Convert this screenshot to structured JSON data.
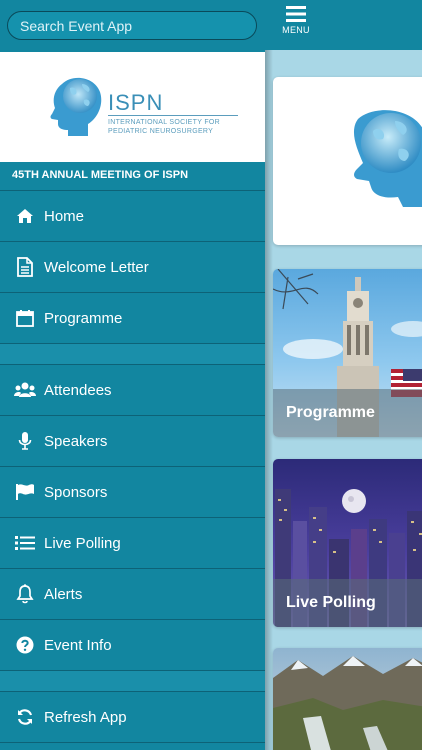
{
  "search": {
    "placeholder": "Search Event App"
  },
  "logo": {
    "name": "ISPN",
    "subtitle": "INTERNATIONAL SOCIETY FOR PEDIATRIC NEUROSURGERY"
  },
  "meeting_title": "45TH ANNUAL MEETING OF ISPN",
  "menu": {
    "items": [
      {
        "label": "Home",
        "icon": "home-icon"
      },
      {
        "label": "Welcome Letter",
        "icon": "document-icon"
      },
      {
        "label": "Programme",
        "icon": "calendar-icon"
      },
      {
        "label": "Attendees",
        "icon": "users-icon"
      },
      {
        "label": "Speakers",
        "icon": "microphone-icon"
      },
      {
        "label": "Sponsors",
        "icon": "flag-icon"
      },
      {
        "label": "Live Polling",
        "icon": "list-icon"
      },
      {
        "label": "Alerts",
        "icon": "bell-icon"
      },
      {
        "label": "Event Info",
        "icon": "question-icon"
      },
      {
        "label": "Refresh App",
        "icon": "refresh-icon"
      }
    ]
  },
  "topbar": {
    "menu_label": "MENU"
  },
  "cards": [
    {
      "label": ""
    },
    {
      "label": "Programme"
    },
    {
      "label": "Live Polling"
    },
    {
      "label": ""
    }
  ],
  "colors": {
    "primary": "#1286a0",
    "divider": "#0d6277",
    "content_bg": "#a9d7e6"
  }
}
